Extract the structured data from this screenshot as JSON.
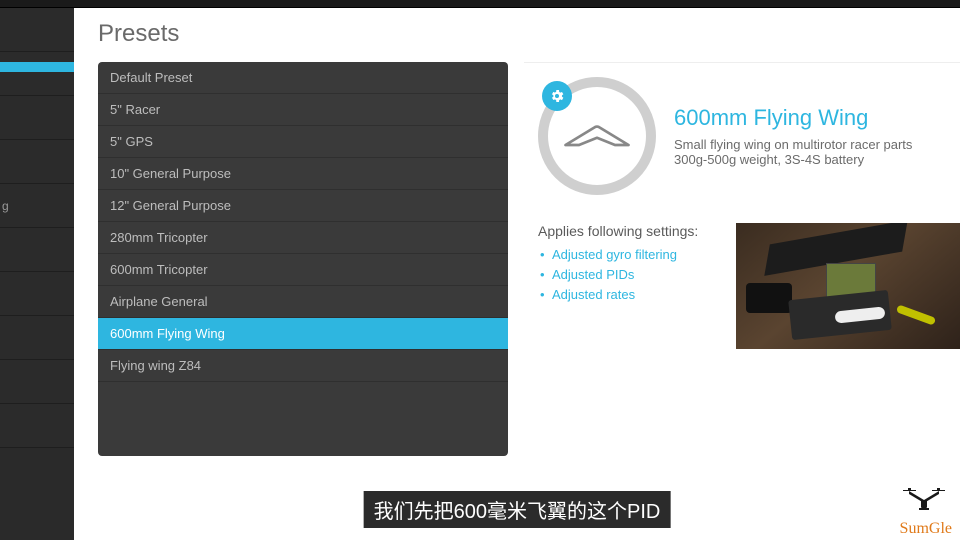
{
  "page": {
    "title": "Presets"
  },
  "leftnav": {
    "truncated_label": "g"
  },
  "presets": {
    "items": [
      {
        "label": "Default Preset"
      },
      {
        "label": "5\" Racer"
      },
      {
        "label": "5\" GPS"
      },
      {
        "label": "10\" General Purpose"
      },
      {
        "label": "12\" General Purpose"
      },
      {
        "label": "280mm Tricopter"
      },
      {
        "label": "600mm Tricopter"
      },
      {
        "label": "Airplane General"
      },
      {
        "label": "600mm Flying Wing"
      },
      {
        "label": "Flying wing Z84"
      }
    ],
    "selected_index": 8
  },
  "detail": {
    "title": "600mm Flying Wing",
    "desc1": "Small flying wing on multirotor racer parts",
    "desc2": "300g-500g weight, 3S-4S battery",
    "settings_heading": "Applies following settings:",
    "settings": [
      "Adjusted gyro filtering",
      "Adjusted PIDs",
      "Adjusted rates"
    ]
  },
  "subtitle": "我们先把600毫米飞翼的这个PID",
  "logo": {
    "text": "SumGle"
  }
}
